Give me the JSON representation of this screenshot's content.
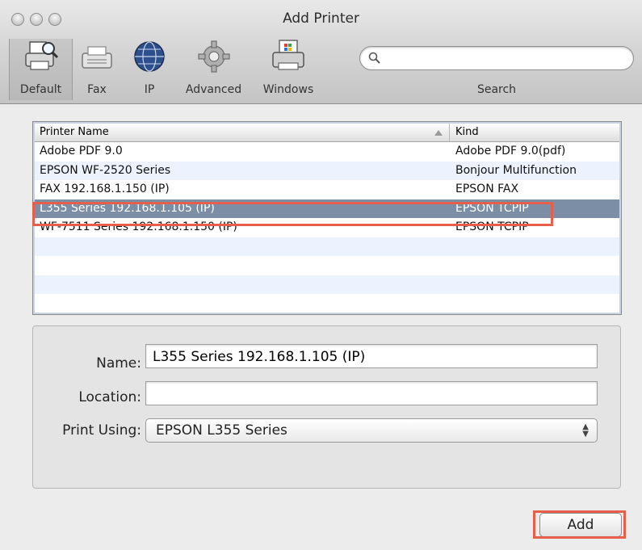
{
  "window": {
    "title": "Add Printer"
  },
  "toolbar": {
    "items": [
      {
        "label": "Default",
        "icon": "printer-magnifier-icon",
        "selected": true
      },
      {
        "label": "Fax",
        "icon": "fax-icon"
      },
      {
        "label": "IP",
        "icon": "globe-icon"
      },
      {
        "label": "Advanced",
        "icon": "gear-icon"
      },
      {
        "label": "Windows",
        "icon": "windows-printer-icon"
      }
    ],
    "search_label": "Search",
    "search_placeholder": ""
  },
  "printer_list": {
    "headers": {
      "name": "Printer Name",
      "kind": "Kind"
    },
    "rows": [
      {
        "name": "Adobe PDF 9.0",
        "kind": "Adobe PDF 9.0(pdf)"
      },
      {
        "name": "EPSON WF-2520 Series",
        "kind": "Bonjour Multifunction"
      },
      {
        "name": "FAX 192.168.1.150 (IP)",
        "kind": "EPSON FAX"
      },
      {
        "name": "L355 Series 192.168.1.105 (IP)",
        "kind": "EPSON TCPIP",
        "selected": true
      },
      {
        "name": "WF-7511 Series 192.168.1.150 (IP)",
        "kind": "EPSON TCPIP"
      }
    ]
  },
  "details": {
    "name_label": "Name:",
    "name_value": "L355 Series 192.168.1.105 (IP)",
    "location_label": "Location:",
    "location_value": "",
    "print_using_label": "Print Using:",
    "print_using_value": "EPSON L355 Series"
  },
  "add_button": "Add",
  "colors": {
    "highlight": "#e65f4b",
    "selected_row": "#7c8ea5",
    "alt_row": "#edf3fe"
  }
}
